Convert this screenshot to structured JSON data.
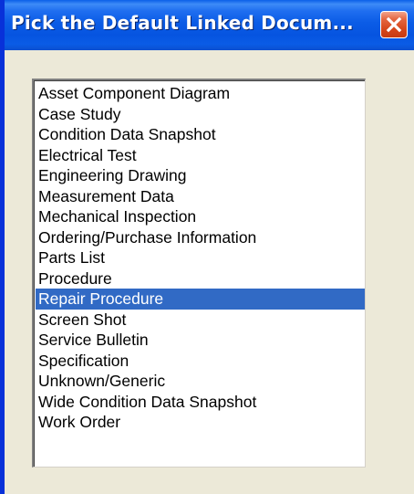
{
  "window": {
    "title": "Pick the Default Linked Docum...",
    "close_icon": "close-icon"
  },
  "list": {
    "items": [
      "Asset Component Diagram",
      "Case Study",
      "Condition Data Snapshot",
      "Electrical Test",
      "Engineering Drawing",
      "Measurement Data",
      "Mechanical Inspection",
      "Ordering/Purchase Information",
      "Parts List",
      "Procedure",
      "Repair Procedure",
      "Screen Shot",
      "Service Bulletin",
      "Specification",
      "Unknown/Generic",
      "Wide Condition Data Snapshot",
      "Work Order"
    ],
    "selected_item": "Repair Procedure"
  },
  "colors": {
    "titlebar": "#0a5ce6",
    "selection": "#316ac5",
    "close_button": "#d54519",
    "dialog_face": "#ece9d8"
  }
}
